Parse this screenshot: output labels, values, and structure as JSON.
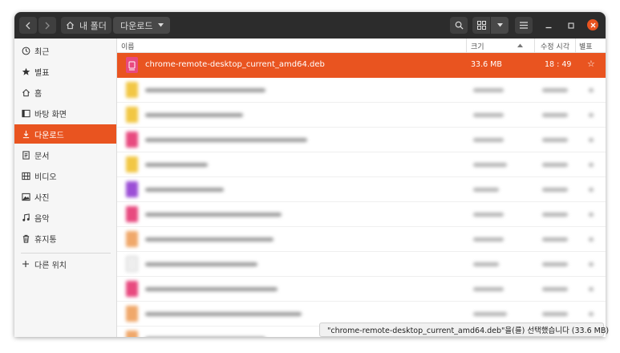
{
  "header": {
    "location_home": "내 폴더",
    "location_current": "다운로드",
    "close_color": "#e95420",
    "header_bg": "#2c2c2c"
  },
  "sidebar": {
    "items": [
      {
        "label": "최근",
        "icon": "clock-icon",
        "active": false
      },
      {
        "label": "별표",
        "icon": "star-icon",
        "active": false
      },
      {
        "label": "홈",
        "icon": "home-icon",
        "active": false
      },
      {
        "label": "바탕 화면",
        "icon": "desktop-icon",
        "active": false
      },
      {
        "label": "다운로드",
        "icon": "download-icon",
        "active": true
      },
      {
        "label": "문서",
        "icon": "document-icon",
        "active": false
      },
      {
        "label": "비디오",
        "icon": "video-icon",
        "active": false
      },
      {
        "label": "사진",
        "icon": "picture-icon",
        "active": false
      },
      {
        "label": "음악",
        "icon": "music-icon",
        "active": false
      },
      {
        "label": "휴지통",
        "icon": "trash-icon",
        "active": false
      }
    ],
    "other_locations": "다른 위치"
  },
  "columns": {
    "name": "이름",
    "size": "크기",
    "modified": "수정 시각",
    "starred": "별표"
  },
  "files": [
    {
      "name": "chrome-remote-desktop_current_amd64.deb",
      "size": "33.6 MB",
      "modified": "18 : 49",
      "selected": true,
      "blurred": false,
      "icon_color": "#e84a7f"
    }
  ],
  "blurred_rows": [
    {
      "icon_color": "#f2c744"
    },
    {
      "icon_color": "#f2c744"
    },
    {
      "icon_color": "#e84a7f"
    },
    {
      "icon_color": "#f2c744"
    },
    {
      "icon_color": "#9b4fd6"
    },
    {
      "icon_color": "#e84a7f"
    },
    {
      "icon_color": "#f0a86a"
    },
    {
      "icon_color": "#eeeeee"
    },
    {
      "icon_color": "#e84a7f"
    },
    {
      "icon_color": "#f0a86a"
    },
    {
      "icon_color": "#f0a86a"
    }
  ],
  "accent": "#e95420",
  "status": "\"chrome-remote-desktop_current_amd64.deb\"을(를) 선택했습니다 (33.6 MB)"
}
